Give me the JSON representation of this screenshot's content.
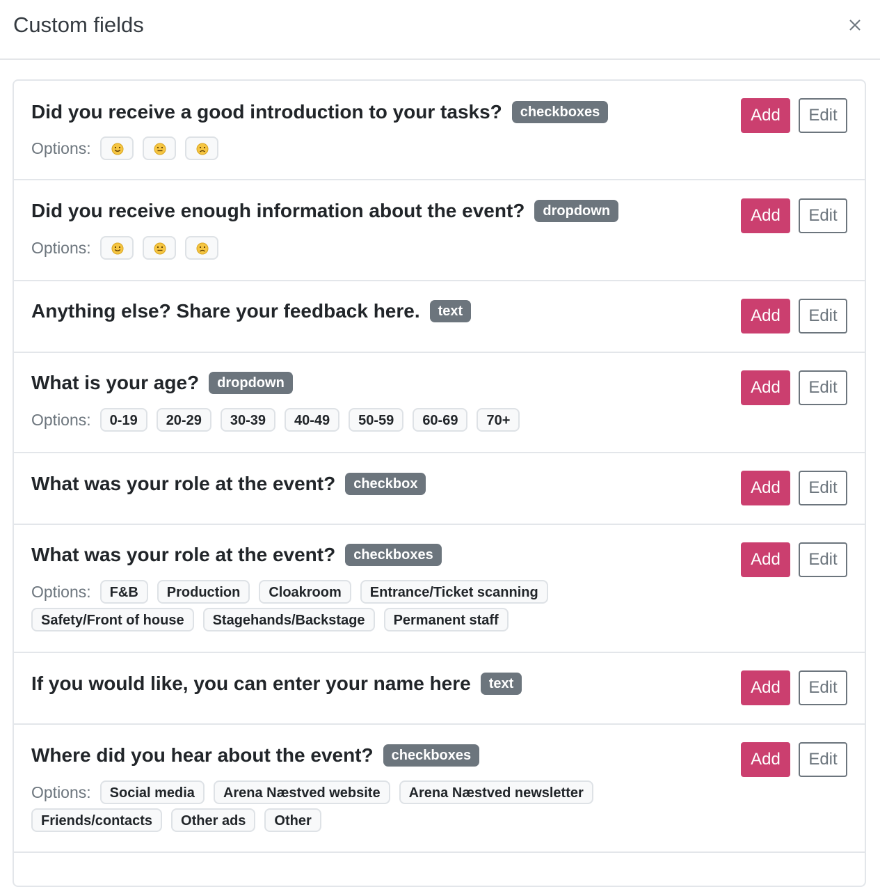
{
  "modal": {
    "title": "Custom fields",
    "close_icon": "close-icon"
  },
  "labels": {
    "options": "Options:",
    "add": "Add",
    "edit": "Edit"
  },
  "fields": [
    {
      "question": "Did you receive a good introduction to your tasks?",
      "type": "checkboxes",
      "options_kind": "emoji",
      "options": [
        "smiling-face-icon",
        "neutral-face-icon",
        "frowning-face-icon"
      ]
    },
    {
      "question": "Did you receive enough information about the event?",
      "type": "dropdown",
      "options_kind": "emoji",
      "options": [
        "smiling-face-icon",
        "neutral-face-icon",
        "frowning-face-icon"
      ]
    },
    {
      "question": "Anything else? Share your feedback here.",
      "type": "text",
      "options_kind": "none",
      "options": []
    },
    {
      "question": "What is your age?",
      "type": "dropdown",
      "options_kind": "text",
      "options": [
        "0-19",
        "20-29",
        "30-39",
        "40-49",
        "50-59",
        "60-69",
        "70+"
      ]
    },
    {
      "question": "What was your role at the event?",
      "type": "checkbox",
      "options_kind": "none",
      "options": []
    },
    {
      "question": "What was your role at the event?",
      "type": "checkboxes",
      "options_kind": "text",
      "options": [
        "F&B",
        "Production",
        "Cloakroom",
        "Entrance/Ticket scanning",
        "Safety/Front of house",
        "Stagehands/Backstage",
        "Permanent staff"
      ]
    },
    {
      "question": "If you would like, you can enter your name here",
      "type": "text",
      "options_kind": "none",
      "options": []
    },
    {
      "question": "Where did you hear about the event?",
      "type": "checkboxes",
      "options_kind": "text",
      "options": [
        "Social media",
        "Arena Næstved website",
        "Arena Næstved newsletter",
        "Friends/contacts",
        "Other ads",
        "Other"
      ]
    }
  ],
  "colors": {
    "add_button": "#cb3f6f",
    "type_badge": "#6c757d",
    "emoji_face": "#f5c542"
  }
}
